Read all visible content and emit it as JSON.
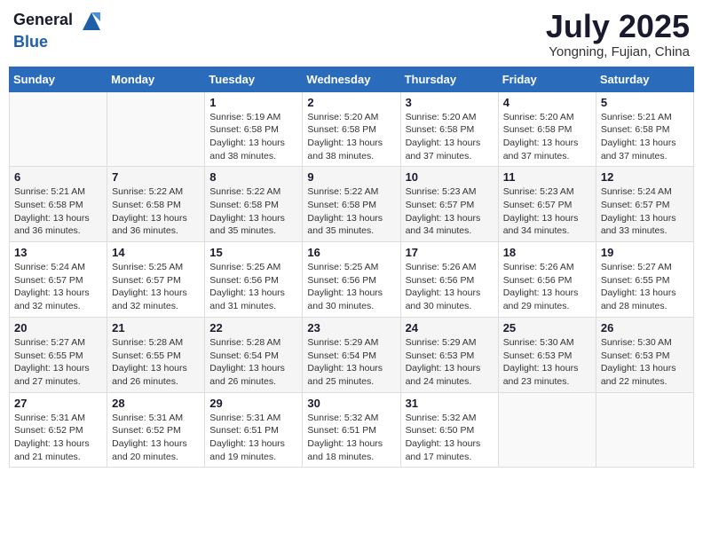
{
  "header": {
    "logo_general": "General",
    "logo_blue": "Blue",
    "month_year": "July 2025",
    "location": "Yongning, Fujian, China"
  },
  "weekdays": [
    "Sunday",
    "Monday",
    "Tuesday",
    "Wednesday",
    "Thursday",
    "Friday",
    "Saturday"
  ],
  "weeks": [
    [
      {
        "day": "",
        "sunrise": "",
        "sunset": "",
        "daylight": ""
      },
      {
        "day": "",
        "sunrise": "",
        "sunset": "",
        "daylight": ""
      },
      {
        "day": "1",
        "sunrise": "Sunrise: 5:19 AM",
        "sunset": "Sunset: 6:58 PM",
        "daylight": "Daylight: 13 hours and 38 minutes."
      },
      {
        "day": "2",
        "sunrise": "Sunrise: 5:20 AM",
        "sunset": "Sunset: 6:58 PM",
        "daylight": "Daylight: 13 hours and 38 minutes."
      },
      {
        "day": "3",
        "sunrise": "Sunrise: 5:20 AM",
        "sunset": "Sunset: 6:58 PM",
        "daylight": "Daylight: 13 hours and 37 minutes."
      },
      {
        "day": "4",
        "sunrise": "Sunrise: 5:20 AM",
        "sunset": "Sunset: 6:58 PM",
        "daylight": "Daylight: 13 hours and 37 minutes."
      },
      {
        "day": "5",
        "sunrise": "Sunrise: 5:21 AM",
        "sunset": "Sunset: 6:58 PM",
        "daylight": "Daylight: 13 hours and 37 minutes."
      }
    ],
    [
      {
        "day": "6",
        "sunrise": "Sunrise: 5:21 AM",
        "sunset": "Sunset: 6:58 PM",
        "daylight": "Daylight: 13 hours and 36 minutes."
      },
      {
        "day": "7",
        "sunrise": "Sunrise: 5:22 AM",
        "sunset": "Sunset: 6:58 PM",
        "daylight": "Daylight: 13 hours and 36 minutes."
      },
      {
        "day": "8",
        "sunrise": "Sunrise: 5:22 AM",
        "sunset": "Sunset: 6:58 PM",
        "daylight": "Daylight: 13 hours and 35 minutes."
      },
      {
        "day": "9",
        "sunrise": "Sunrise: 5:22 AM",
        "sunset": "Sunset: 6:58 PM",
        "daylight": "Daylight: 13 hours and 35 minutes."
      },
      {
        "day": "10",
        "sunrise": "Sunrise: 5:23 AM",
        "sunset": "Sunset: 6:57 PM",
        "daylight": "Daylight: 13 hours and 34 minutes."
      },
      {
        "day": "11",
        "sunrise": "Sunrise: 5:23 AM",
        "sunset": "Sunset: 6:57 PM",
        "daylight": "Daylight: 13 hours and 34 minutes."
      },
      {
        "day": "12",
        "sunrise": "Sunrise: 5:24 AM",
        "sunset": "Sunset: 6:57 PM",
        "daylight": "Daylight: 13 hours and 33 minutes."
      }
    ],
    [
      {
        "day": "13",
        "sunrise": "Sunrise: 5:24 AM",
        "sunset": "Sunset: 6:57 PM",
        "daylight": "Daylight: 13 hours and 32 minutes."
      },
      {
        "day": "14",
        "sunrise": "Sunrise: 5:25 AM",
        "sunset": "Sunset: 6:57 PM",
        "daylight": "Daylight: 13 hours and 32 minutes."
      },
      {
        "day": "15",
        "sunrise": "Sunrise: 5:25 AM",
        "sunset": "Sunset: 6:56 PM",
        "daylight": "Daylight: 13 hours and 31 minutes."
      },
      {
        "day": "16",
        "sunrise": "Sunrise: 5:25 AM",
        "sunset": "Sunset: 6:56 PM",
        "daylight": "Daylight: 13 hours and 30 minutes."
      },
      {
        "day": "17",
        "sunrise": "Sunrise: 5:26 AM",
        "sunset": "Sunset: 6:56 PM",
        "daylight": "Daylight: 13 hours and 30 minutes."
      },
      {
        "day": "18",
        "sunrise": "Sunrise: 5:26 AM",
        "sunset": "Sunset: 6:56 PM",
        "daylight": "Daylight: 13 hours and 29 minutes."
      },
      {
        "day": "19",
        "sunrise": "Sunrise: 5:27 AM",
        "sunset": "Sunset: 6:55 PM",
        "daylight": "Daylight: 13 hours and 28 minutes."
      }
    ],
    [
      {
        "day": "20",
        "sunrise": "Sunrise: 5:27 AM",
        "sunset": "Sunset: 6:55 PM",
        "daylight": "Daylight: 13 hours and 27 minutes."
      },
      {
        "day": "21",
        "sunrise": "Sunrise: 5:28 AM",
        "sunset": "Sunset: 6:55 PM",
        "daylight": "Daylight: 13 hours and 26 minutes."
      },
      {
        "day": "22",
        "sunrise": "Sunrise: 5:28 AM",
        "sunset": "Sunset: 6:54 PM",
        "daylight": "Daylight: 13 hours and 26 minutes."
      },
      {
        "day": "23",
        "sunrise": "Sunrise: 5:29 AM",
        "sunset": "Sunset: 6:54 PM",
        "daylight": "Daylight: 13 hours and 25 minutes."
      },
      {
        "day": "24",
        "sunrise": "Sunrise: 5:29 AM",
        "sunset": "Sunset: 6:53 PM",
        "daylight": "Daylight: 13 hours and 24 minutes."
      },
      {
        "day": "25",
        "sunrise": "Sunrise: 5:30 AM",
        "sunset": "Sunset: 6:53 PM",
        "daylight": "Daylight: 13 hours and 23 minutes."
      },
      {
        "day": "26",
        "sunrise": "Sunrise: 5:30 AM",
        "sunset": "Sunset: 6:53 PM",
        "daylight": "Daylight: 13 hours and 22 minutes."
      }
    ],
    [
      {
        "day": "27",
        "sunrise": "Sunrise: 5:31 AM",
        "sunset": "Sunset: 6:52 PM",
        "daylight": "Daylight: 13 hours and 21 minutes."
      },
      {
        "day": "28",
        "sunrise": "Sunrise: 5:31 AM",
        "sunset": "Sunset: 6:52 PM",
        "daylight": "Daylight: 13 hours and 20 minutes."
      },
      {
        "day": "29",
        "sunrise": "Sunrise: 5:31 AM",
        "sunset": "Sunset: 6:51 PM",
        "daylight": "Daylight: 13 hours and 19 minutes."
      },
      {
        "day": "30",
        "sunrise": "Sunrise: 5:32 AM",
        "sunset": "Sunset: 6:51 PM",
        "daylight": "Daylight: 13 hours and 18 minutes."
      },
      {
        "day": "31",
        "sunrise": "Sunrise: 5:32 AM",
        "sunset": "Sunset: 6:50 PM",
        "daylight": "Daylight: 13 hours and 17 minutes."
      },
      {
        "day": "",
        "sunrise": "",
        "sunset": "",
        "daylight": ""
      },
      {
        "day": "",
        "sunrise": "",
        "sunset": "",
        "daylight": ""
      }
    ]
  ]
}
